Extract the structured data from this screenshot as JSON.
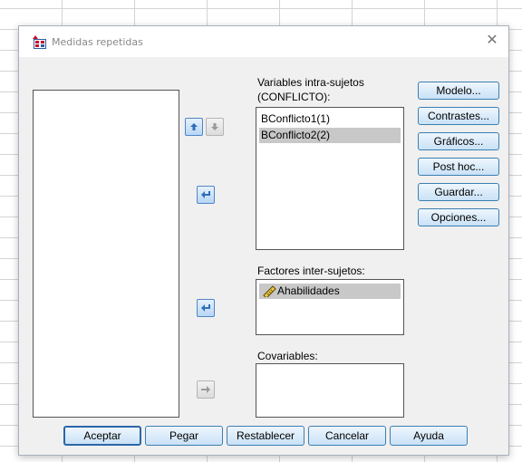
{
  "window": {
    "title": "Medidas repetidas",
    "close_glyph": "✕"
  },
  "lists": {
    "within_label_line1": "Variables intra-sujetos",
    "within_label_line2": "(CONFLICTO):",
    "within_items": [
      "BConflicto1(1)",
      "BConflicto2(2)"
    ],
    "between_label": "Factores inter-sujetos:",
    "between_items": [
      "Ahabilidades"
    ],
    "covariates_label": "Covariables:"
  },
  "side_buttons": {
    "modelo": "Modelo...",
    "contrastes": "Contrastes...",
    "graficos": "Gráficos...",
    "posthoc": "Post hoc...",
    "guardar": "Guardar...",
    "opciones": "Opciones..."
  },
  "bottom_buttons": {
    "aceptar": "Aceptar",
    "pegar": "Pegar",
    "restablecer": "Restablecer",
    "cancelar": "Cancelar",
    "ayuda": "Ayuda"
  },
  "icons": {
    "app": "spss-dialog-icon",
    "move_up": "arrow-up-icon",
    "move_down": "arrow-down-icon",
    "move_to_within": "arrow-right-icon",
    "move_to_between": "arrow-right-icon",
    "move_to_covariates": "arrow-right-icon",
    "ruler": "scale-variable-icon"
  },
  "colors": {
    "selection": "#c8c8c8",
    "button_border": "#3c7fb1",
    "arrow_blue": "#2e6fb7"
  }
}
